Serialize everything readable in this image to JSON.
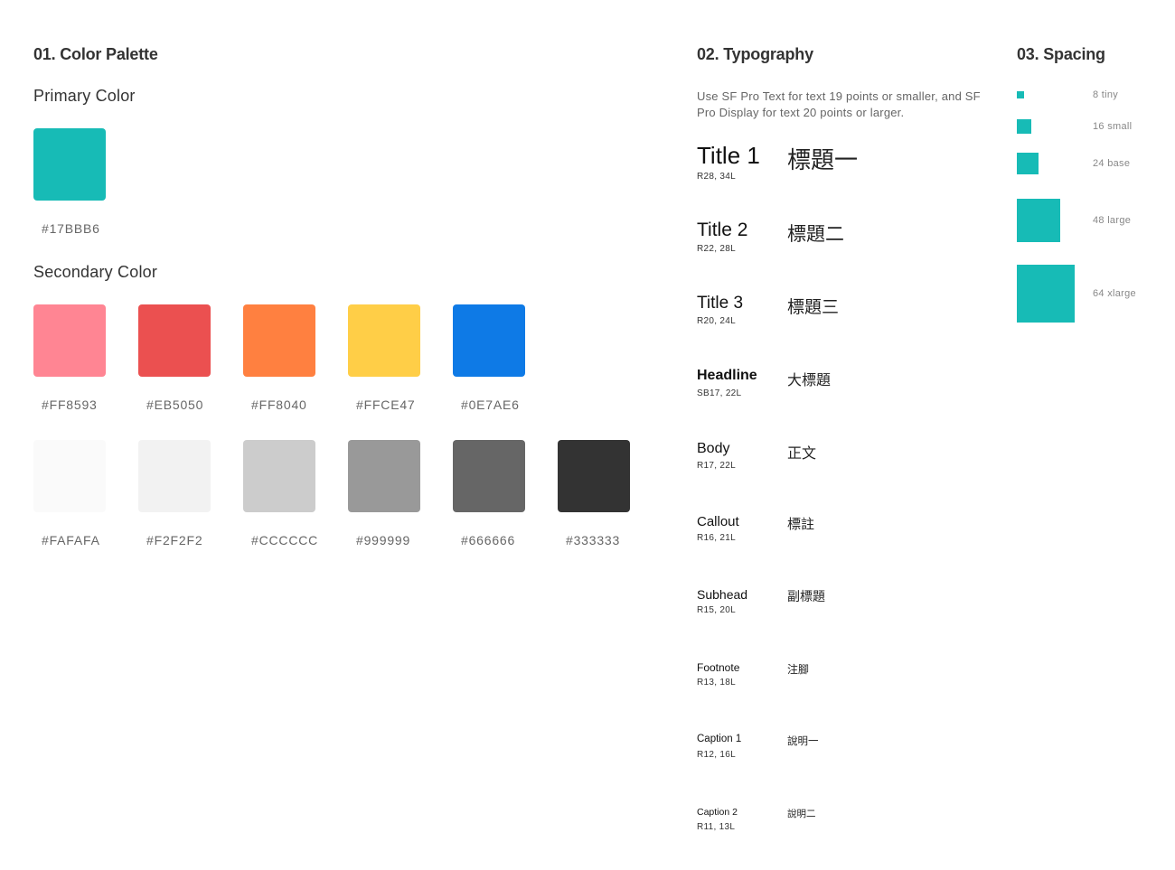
{
  "palette": {
    "title": "01. Color Palette",
    "primary": {
      "label": "Primary Color",
      "colors": [
        {
          "hex": "#17BBB6",
          "label": "#17BBB6"
        }
      ]
    },
    "secondary": {
      "label": "Secondary Color",
      "row1": [
        {
          "hex": "#FF8593",
          "label": "#FF8593"
        },
        {
          "hex": "#EB5050",
          "label": "#EB5050"
        },
        {
          "hex": "#FF8040",
          "label": "#FF8040"
        },
        {
          "hex": "#FFCE47",
          "label": "#FFCE47"
        },
        {
          "hex": "#0E7AE6",
          "label": "#0E7AE6"
        }
      ],
      "row2": [
        {
          "hex": "#FAFAFA",
          "label": "#FAFAFA"
        },
        {
          "hex": "#F2F2F2",
          "label": "#F2F2F2"
        },
        {
          "hex": "#CCCCCC",
          "label": "#CCCCCC"
        },
        {
          "hex": "#999999",
          "label": "#999999"
        },
        {
          "hex": "#666666",
          "label": "#666666"
        },
        {
          "hex": "#333333",
          "label": "#333333"
        }
      ]
    }
  },
  "typography": {
    "title": "02. Typography",
    "description": "Use SF Pro Text for text 19 points or smaller, and SF Pro Display for text 20 points or larger.",
    "styles": [
      {
        "name": "Title 1",
        "spec": "R28, 34L",
        "cjk": "標題一"
      },
      {
        "name": "Title 2",
        "spec": "R22, 28L",
        "cjk": "標題二"
      },
      {
        "name": "Title 3",
        "spec": "R20, 24L",
        "cjk": "標題三"
      },
      {
        "name": "Headline",
        "spec": "SB17, 22L",
        "cjk": "大標題"
      },
      {
        "name": "Body",
        "spec": "R17, 22L",
        "cjk": "正文"
      },
      {
        "name": "Callout",
        "spec": "R16, 21L",
        "cjk": "標註"
      },
      {
        "name": "Subhead",
        "spec": "R15, 20L",
        "cjk": "副標題"
      },
      {
        "name": "Footnote",
        "spec": "R13, 18L",
        "cjk": "注腳"
      },
      {
        "name": "Caption 1",
        "spec": "R12, 16L",
        "cjk": "說明一"
      },
      {
        "name": "Caption 2",
        "spec": "R11, 13L",
        "cjk": "說明二"
      }
    ]
  },
  "spacing": {
    "title": "03. Spacing",
    "color": "#17BBB6",
    "items": [
      {
        "size": 8,
        "label": "8 tiny"
      },
      {
        "size": 16,
        "label": "16 small"
      },
      {
        "size": 24,
        "label": "24 base"
      },
      {
        "size": 48,
        "label": "48 large"
      },
      {
        "size": 64,
        "label": "64 xlarge"
      }
    ]
  }
}
